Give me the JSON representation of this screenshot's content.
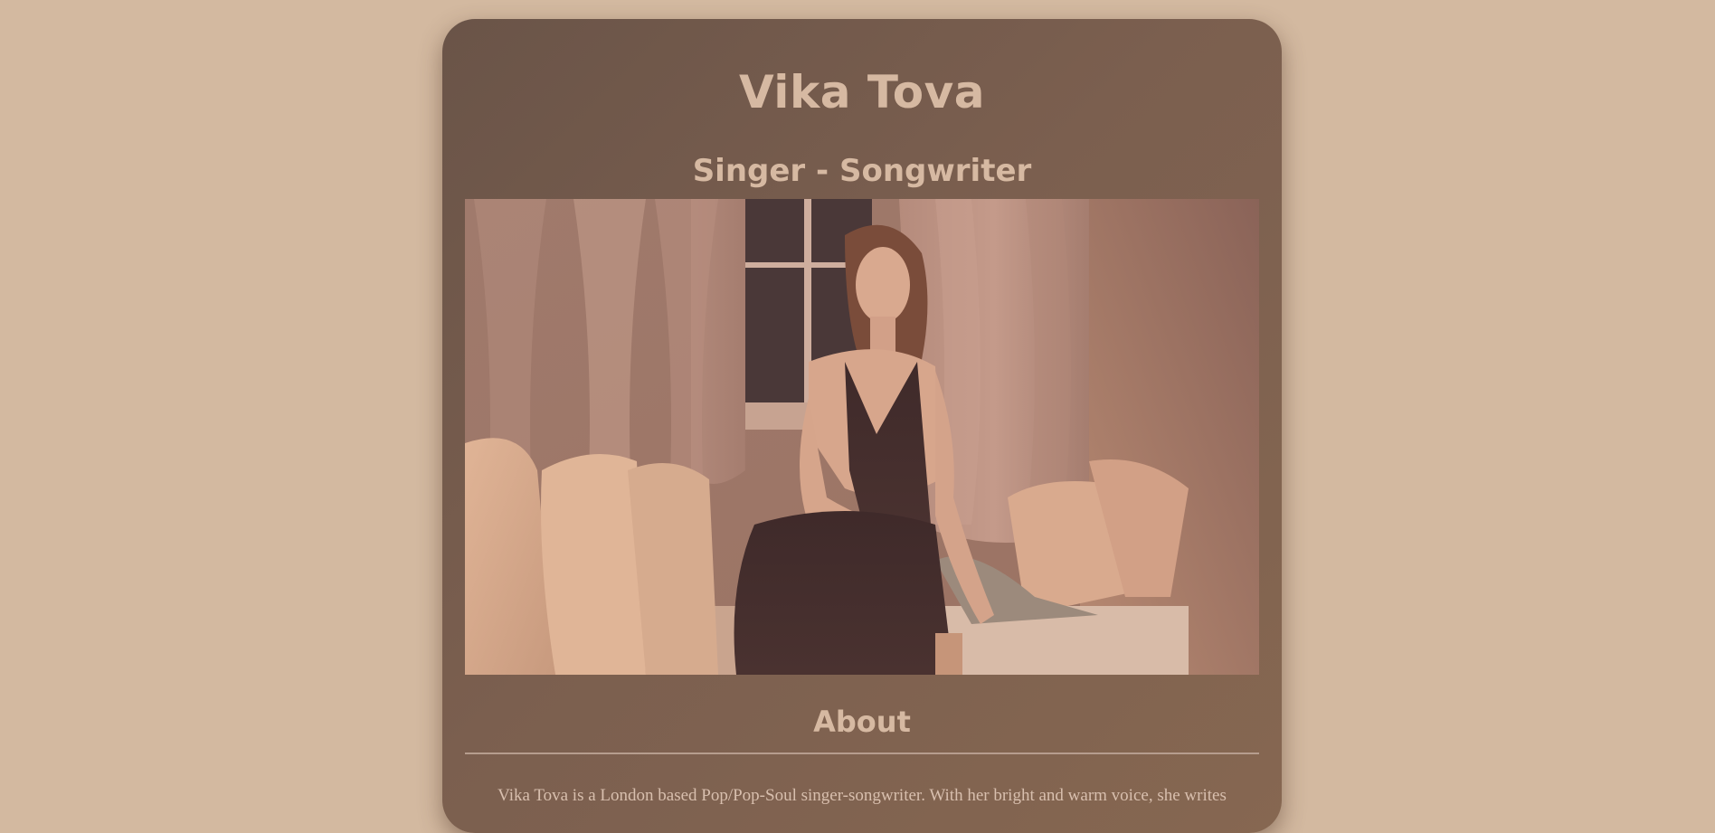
{
  "header": {
    "title": "Vika Tova",
    "subtitle": "Singer - Songwriter"
  },
  "hero": {
    "image_description_icon": "photo-icon"
  },
  "about": {
    "heading": "About",
    "text": "Vika Tova is a London based Pop/Pop-Soul singer-songwriter. With her bright and warm voice, she writes"
  },
  "colors": {
    "page_background": "#d3b9a0",
    "card_background": "#75594b",
    "heading_text": "#d6b9a2"
  }
}
